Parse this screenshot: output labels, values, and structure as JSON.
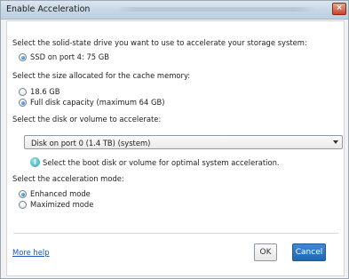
{
  "window": {
    "title": "Enable Acceleration",
    "close_label": "×"
  },
  "sections": {
    "drive_prompt": "Select the solid-state drive you want to use to accelerate your storage system:",
    "drive_option": "SSD on port 4: 75 GB",
    "size_prompt": "Select the size allocated for the cache memory:",
    "size_options": [
      "18.6 GB",
      "Full disk capacity (maximum 64 GB)"
    ],
    "size_selected": "Full disk capacity (maximum 64 GB)",
    "disk_prompt": "Select the disk or volume to accelerate:",
    "disk_select_value": "Disk on port 0 (1.4 TB) (system)",
    "disk_hint": "Select the boot disk or volume for optimal system acceleration.",
    "mode_prompt": "Select the acceleration mode:",
    "mode_options": [
      "Enhanced mode",
      "Maximized mode"
    ],
    "mode_selected": "Enhanced mode"
  },
  "footer": {
    "help_link": "More help",
    "ok_label": "OK",
    "cancel_label": "Cancel"
  },
  "colors": {
    "accent": "#1f66b3",
    "link": "#1a55b5",
    "info": "#25a7ad"
  }
}
